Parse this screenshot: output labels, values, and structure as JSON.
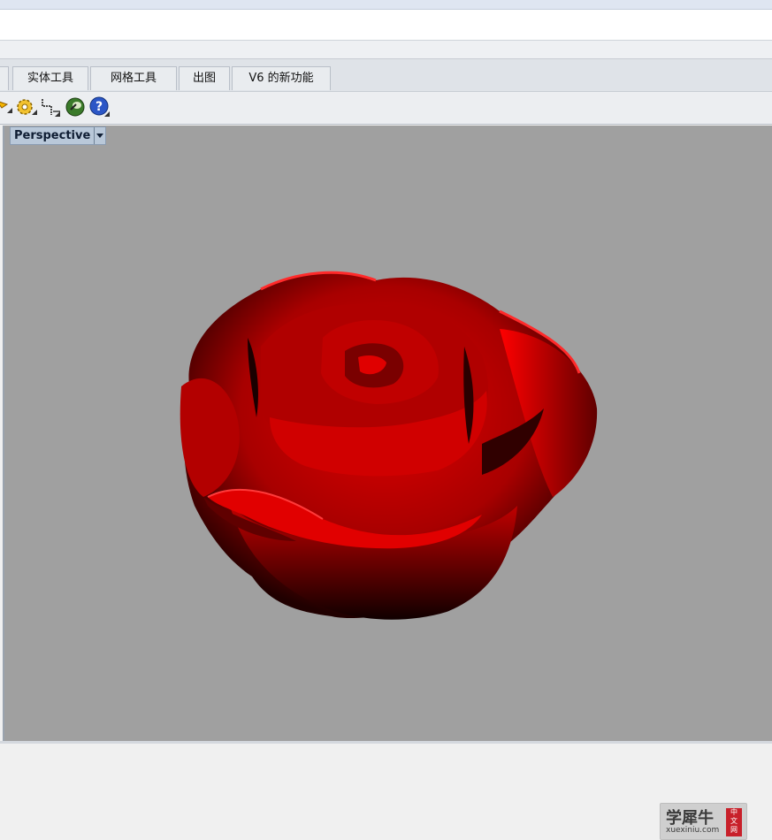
{
  "tabs": [
    {
      "label": "实体工具"
    },
    {
      "label": "网格工具"
    },
    {
      "label": "出图"
    },
    {
      "label": "V6 的新功能"
    }
  ],
  "toolbar_icons": [
    "select-arrow-icon",
    "gear-settings-icon",
    "dimension-icon",
    "render-sphere-icon",
    "help-icon"
  ],
  "viewport": {
    "name": "Perspective",
    "background": "#a0a0a0"
  },
  "object": {
    "description_color": "#d00000"
  },
  "watermark": {
    "cn": "学犀牛",
    "en": "xuexiniu.com",
    "seal": [
      "中",
      "文",
      "网"
    ]
  }
}
